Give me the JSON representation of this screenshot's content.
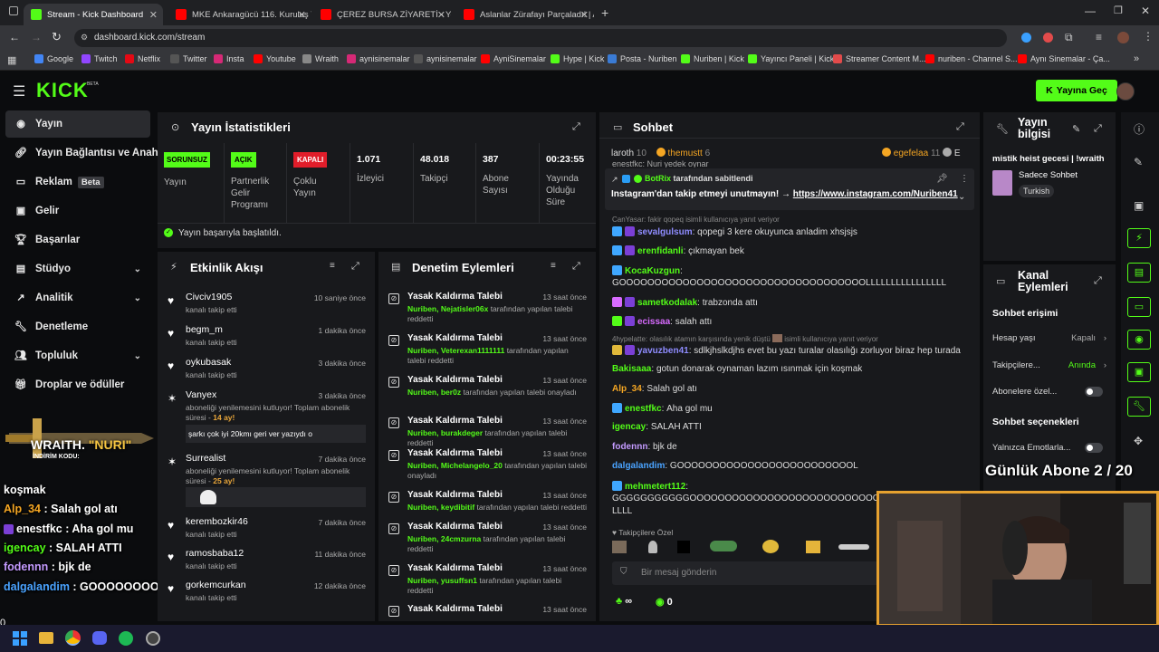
{
  "browser": {
    "tabs": [
      {
        "label": "Stream - Kick Dashboard",
        "active": true
      },
      {
        "label": "MKE Ankaragücü 116. Kuruluş Y"
      },
      {
        "label": "ÇEREZ BURSA ZİYARETİ - YouTu"
      },
      {
        "label": "Aslanlar Zürafayı Parçaladı! | Af"
      }
    ],
    "url": "dashboard.kick.com/stream",
    "bookmarks": [
      "Google",
      "Twitch",
      "Netflix",
      "Twitter",
      "Insta",
      "Youtube",
      "Wraith",
      "aynisinemalar",
      "aynisinemalar",
      "AyniSinemalar",
      "Hype | Kick",
      "Posta - Nuriben",
      "Nuriben | Kick",
      "Yayıncı Paneli | Kick",
      "Streamer Content M...",
      "nuriben - Channel S...",
      "Aynı Sinemalar - Ça..."
    ]
  },
  "kick": {
    "logo": "KICK",
    "beta": "BETA",
    "go_live": "Yayına Geç"
  },
  "sidebar": {
    "items": [
      "Yayın",
      "Yayın Bağlantısı ve Anahtar",
      "Reklam",
      "Gelir",
      "Başarılar",
      "Stüdyo",
      "Analitik",
      "Denetleme",
      "Topluluk",
      "Droplar ve ödüller"
    ],
    "beta": "Beta"
  },
  "stats": {
    "title": "Yayın İstatistikleri",
    "cols": [
      {
        "badge": "SORUNSUZ",
        "label": "Yayın"
      },
      {
        "badge": "AÇIK",
        "label": "Partnerlik Gelir Programı"
      },
      {
        "badge": "KAPALI",
        "label": "Çoklu Yayın"
      },
      {
        "value": "1.071",
        "label": "İzleyici"
      },
      {
        "value": "48.018",
        "label": "Takipçi"
      },
      {
        "value": "387",
        "label": "Abone Sayısı"
      },
      {
        "value": "00:23:55",
        "label": "Yayında Olduğu Süre"
      }
    ],
    "status": "Yayın başarıyla başlatıldı."
  },
  "activity": {
    "title": "Etkinlik Akışı",
    "items": [
      {
        "name": "Civciv1905",
        "sub": "kanalı takip etti",
        "time": "10 saniye önce"
      },
      {
        "name": "begm_m",
        "sub": "kanalı takip etti",
        "time": "1 dakika önce"
      },
      {
        "name": "oykubasak",
        "sub": "kanalı takip etti",
        "time": "3 dakika önce"
      },
      {
        "name": "Vanyex",
        "sub": "aboneliği yenilemesini kutluyor! Toplam abonelik süresi -",
        "months": "14 ay!",
        "msg": "şarkı çok iyi 20kmı geri ver yazıydı o",
        "time": "3 dakika önce"
      },
      {
        "name": "Surrealist",
        "sub": "aboneliği yenilemesini kutluyor! Toplam abonelik süresi -",
        "months": "25 ay!",
        "time": "7 dakika önce"
      },
      {
        "name": "kerembozkir46",
        "sub": "kanalı takip etti",
        "time": "7 dakika önce"
      },
      {
        "name": "ramosbaba12",
        "sub": "kanalı takip etti",
        "time": "11 dakika önce"
      },
      {
        "name": "gorkemcurkan",
        "sub": "kanalı takip etti",
        "time": "12 dakika önce"
      }
    ]
  },
  "moderation": {
    "title": "Denetim Eylemleri",
    "items": [
      {
        "title": "Yasak Kaldırma Talebi",
        "time": "13 saat önce",
        "mod": "Nuriben,",
        "user": "Nejatisler06x",
        "action": "tarafından yapılan talebi reddetti"
      },
      {
        "title": "Yasak Kaldırma Talebi",
        "time": "13 saat önce",
        "mod": "Nuriben,",
        "user": "Veterexan1111111",
        "action": "tarafından yapılan talebi reddetti"
      },
      {
        "title": "Yasak Kaldırma Talebi",
        "time": "13 saat önce",
        "mod": "Nuriben,",
        "user": "ber0z",
        "action": "tarafından yapılan talebi onayladı"
      },
      {
        "title": "Yasak Kaldırma Talebi",
        "time": "13 saat önce",
        "mod": "Nuriben,",
        "user": "burakdeger",
        "action": "tarafından yapılan talebi reddetti"
      },
      {
        "title": "Yasak Kaldırma Talebi",
        "time": "13 saat önce",
        "mod": "Nuriben,",
        "user": "Michelangelo_20",
        "action": "tarafından yapılan talebi onayladı"
      },
      {
        "title": "Yasak Kaldırma Talebi",
        "time": "13 saat önce",
        "mod": "Nuriben,",
        "user": "keydibitif",
        "action": "tarafından yapılan talebi reddetti"
      },
      {
        "title": "Yasak Kaldırma Talebi",
        "time": "13 saat önce",
        "mod": "Nuriben,",
        "user": "24cmzurna",
        "action": "tarafından yapılan talebi reddetti"
      },
      {
        "title": "Yasak Kaldırma Talebi",
        "time": "13 saat önce",
        "mod": "Nuriben,",
        "user": "yusuffsn1",
        "action": "tarafından yapılan talebi reddetti"
      },
      {
        "title": "Yasak Kaldırma Talebi",
        "time": "13 saat önce"
      }
    ]
  },
  "chat": {
    "title": "Sohbet",
    "top": [
      {
        "name": "laroth",
        "count": "10"
      },
      {
        "name": "themustt",
        "count": "6"
      },
      {
        "name": "egefelaa",
        "count": "11"
      },
      {
        "name": "E"
      }
    ],
    "partial": "enestfkc: Nuri yedek oynar",
    "pinned_by": "BotRix",
    "pinned_label": "tarafından sabitlendi",
    "pinned_text": "Instagram'dan takip etmeyi unutmayın! →",
    "pinned_link": "https://www.instagram.com/Nuriben41",
    "reply_ctx": "CanYasar: fakir qopeq isimli kullanıcıya yanıt veriyor",
    "messages": [
      {
        "user": "sevalgulsum",
        "color": "#8f8cff",
        "text": "qopegi 3 kere okuyunca anladim xhsjsjs"
      },
      {
        "user": "erenfidanli",
        "color": "#53fc18",
        "text": "çıkmayan bek"
      },
      {
        "user": "KocaKuzgun",
        "color": "#53fc18",
        "text": ""
      },
      {
        "user": "",
        "color": "#ddd",
        "text": "GOOOOOOOOOOOOOOOOOOOOOOOOOOOOOOOOOOOLLLLLLLLLLLLLLLL"
      },
      {
        "user": "sametkodalak",
        "color": "#53fc18",
        "text": "trabzonda attı"
      },
      {
        "user": "ecissaa",
        "color": "#d86bff",
        "text": "salah attı"
      },
      {
        "user": "yavuzben41",
        "color": "#8f8cff",
        "text": "sdlkjhslkdjhs evet bu yazı turalar olasılığı zorluyor biraz hep turada"
      },
      {
        "user": "Bakisaaa",
        "color": "#53fc18",
        "text": "gotun donarak oynaman lazım ısınmak için koşmak"
      },
      {
        "user": "Alp_34",
        "color": "#f5a623",
        "text": "Salah gol atı"
      },
      {
        "user": "enestfkc",
        "color": "#53fc18",
        "text": "Aha gol mu"
      },
      {
        "user": "igencay",
        "color": "#53fc18",
        "text": "SALAH ATTI"
      },
      {
        "user": "fodennn",
        "color": "#c49bff",
        "text": "bjk de"
      },
      {
        "user": "dalgalandim",
        "color": "#4aa3ff",
        "text": "GOOOOOOOOOOOOOOOOOOOOOOOOOL"
      },
      {
        "user": "mehmetert112",
        "color": "#53fc18",
        "text": ""
      },
      {
        "user": "",
        "color": "#ddd",
        "text": "GGGGGGGGGGGOOOOOOOOOOOOOOOOOOOOOOOOOOOOOOOOOLLLLLLL"
      },
      {
        "user": "",
        "color": "#ddd",
        "text": "LLLL"
      }
    ],
    "reply_ctx2": "4hypelatte: olasılık atamın karşısında yenik düştü",
    "reply_ctx2b": "isimli kullanıcıya yanıt veriyor",
    "followers_only": "Takipçilere Özel",
    "input_placeholder": "Bir mesaj gönderin",
    "points": "∞",
    "kicks": "0"
  },
  "info": {
    "title": "Yayın bilgisi",
    "stream_title": "mistik heist gecesi | !wraith",
    "category": "Sadece Sohbet",
    "tag": "Turkish"
  },
  "channel": {
    "title": "Kanal Eylemleri",
    "access_head": "Sohbet erişimi",
    "rows": [
      {
        "label": "Hesap yaşı",
        "value": "Kapalı"
      },
      {
        "label": "Takipçilere...",
        "value": "Anında"
      },
      {
        "label": "Abonelere özel..."
      }
    ],
    "opts_head": "Sohbet seçenekleri",
    "opt1": "Yalnızca Emotlarla..."
  },
  "overlay": {
    "brand": "WRAITH.",
    "code": "NURI",
    "code_label": "İNDİRİM KODU:",
    "sub_goal": "Günlük Abone 2 / 20",
    "chat": [
      {
        "user": "",
        "text": "koşmak"
      },
      {
        "user": "Alp_34",
        "text": "Salah gol atı"
      },
      {
        "user": "enestfkc",
        "text": "Aha gol mu"
      },
      {
        "user": "igencay",
        "text": "SALAH ATTI"
      },
      {
        "user": "fodennn",
        "text": "bjk de"
      },
      {
        "user": "dalgalandim",
        "text": "GOOOOOOOOOOOOOOOOOOOOOOOOOL"
      }
    ],
    "zero": "0"
  }
}
